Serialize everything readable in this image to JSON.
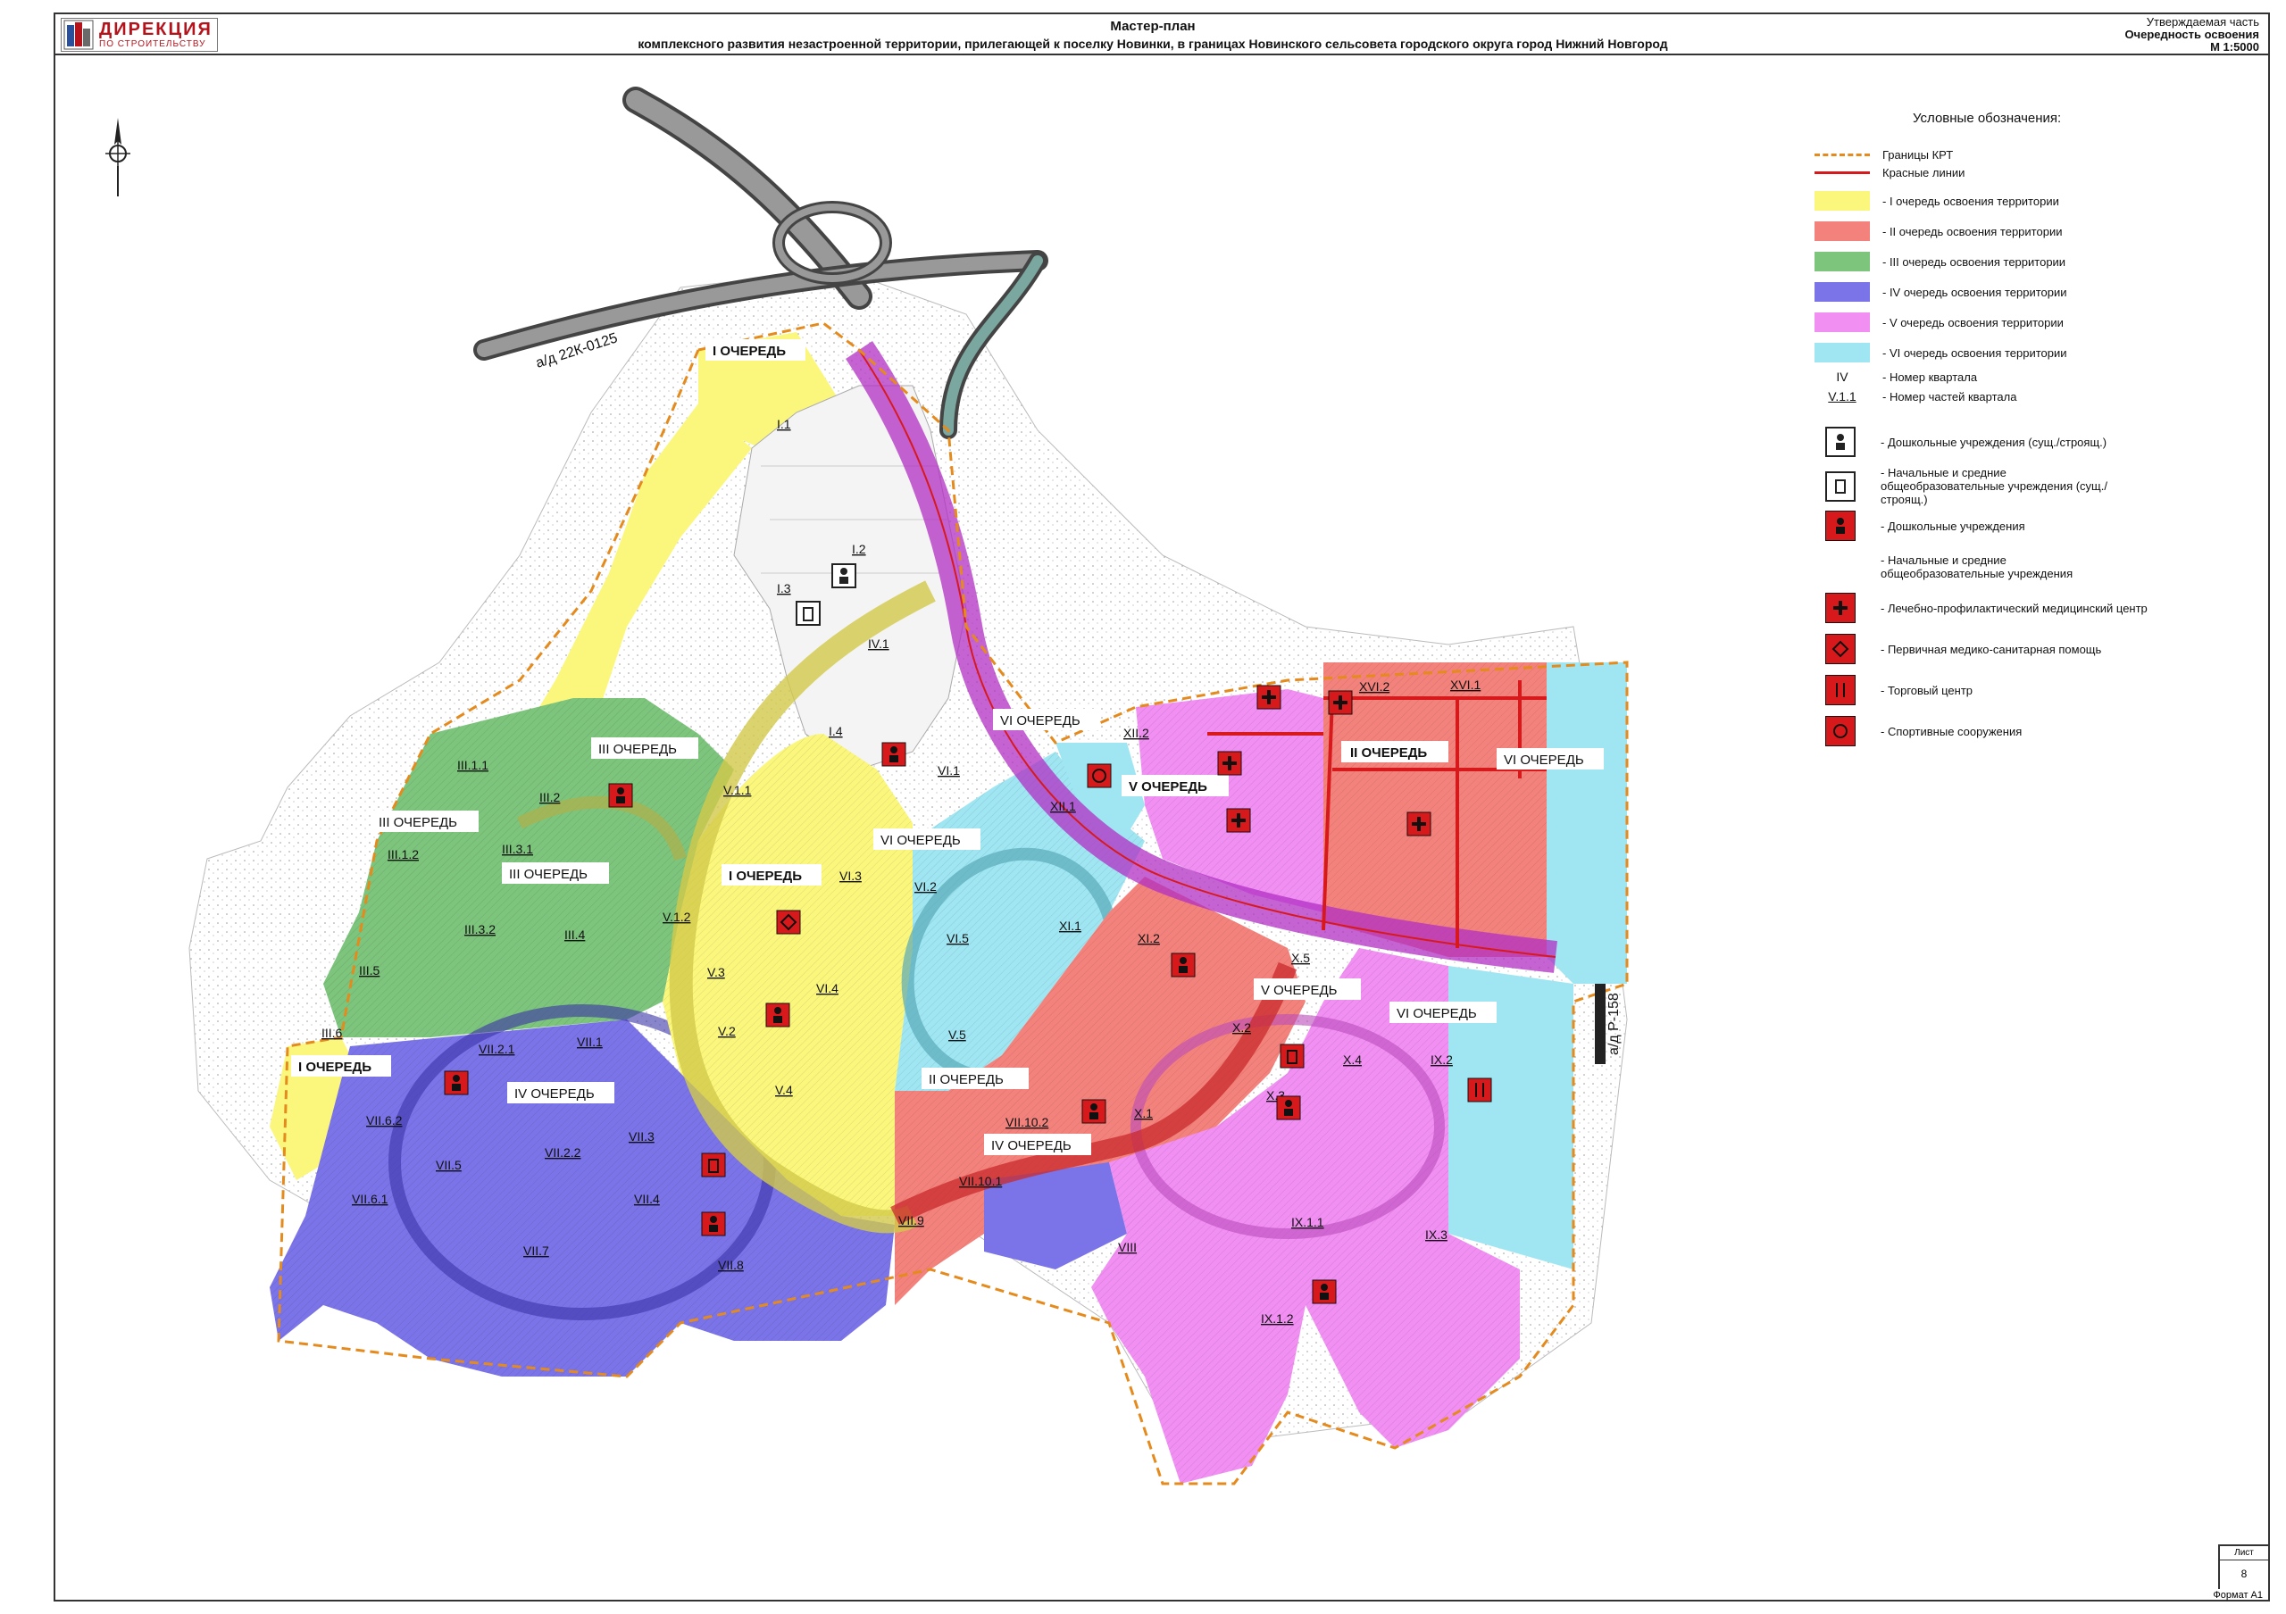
{
  "title_block": {
    "logo": {
      "line1": "ДИРЕКЦИЯ",
      "line2": "ПО СТРОИТЕЛЬСТВУ"
    },
    "title": "Мастер-план",
    "subtitle": "комплексного развития незастроенной территории, прилегающей к поселку Новинки, в границах Новинского сельсовета городского округа город Нижний Новгород",
    "right_top": "Утверждаемая часть",
    "right_mid": "Очередность освоения",
    "right_scale": "М 1:5000"
  },
  "legend": {
    "heading": "Условные обозначения:",
    "lines": [
      {
        "label": "Границы КРТ",
        "color": "#e58a1c",
        "style": "dashed"
      },
      {
        "label": "Красные линии",
        "color": "#d7191c",
        "style": "solid"
      }
    ],
    "phases": [
      {
        "label": "- I очередь освоения территории",
        "color": "#fbf77d"
      },
      {
        "label": "- II очередь освоения территории",
        "color": "#f4827c"
      },
      {
        "label": "- III очередь освоения территории",
        "color": "#7dc47c"
      },
      {
        "label": "- IV очередь освоения территории",
        "color": "#7b74e8"
      },
      {
        "label": "- V очередь освоения территории",
        "color": "#f18ff3"
      },
      {
        "label": "- VI очередь освоения территории",
        "color": "#9fe6f2"
      }
    ],
    "codes": [
      {
        "code": "IV",
        "label": "- Номер квартала"
      },
      {
        "code": "V.1.1",
        "label": "- Номер частей квартала"
      }
    ],
    "icons": [
      {
        "icon": "kindergarten-icon",
        "variant": "outline",
        "label": "- Дошкольные учреждения (сущ./строящ.)"
      },
      {
        "icon": "school-icon",
        "variant": "outline",
        "label": "- Начальные и средние общеобразовательные учреждения (сущ./строящ.)"
      },
      {
        "icon": "kindergarten-icon",
        "variant": "red",
        "label": "- Дошкольные учреждения"
      },
      {
        "icon": "school-icon",
        "variant": "none",
        "label": "- Начальные и средние общеобразовательные учреждения"
      },
      {
        "icon": "medical-cross-icon",
        "variant": "red",
        "label": "- Лечебно-профилактический медицинский центр"
      },
      {
        "icon": "primary-care-icon",
        "variant": "red",
        "label": "- Первичная медико-санитарная помощь"
      },
      {
        "icon": "shopping-icon",
        "variant": "red",
        "label": "- Торговый центр"
      },
      {
        "icon": "sports-icon",
        "variant": "red",
        "label": "- Спортивные сооружения"
      }
    ]
  },
  "map": {
    "roads": [
      {
        "label": "а/д 22К-0125"
      },
      {
        "label": "а/д Р-158"
      }
    ],
    "phase_labels": [
      {
        "text": "I ОЧЕРЕДЬ",
        "bold": true
      },
      {
        "text": "I ОЧЕРЕДЬ",
        "bold": true
      },
      {
        "text": "I ОЧЕРЕДЬ",
        "bold": true
      },
      {
        "text": "II ОЧЕРЕДЬ",
        "bold": true
      },
      {
        "text": "II ОЧЕРЕДЬ",
        "bold": false
      },
      {
        "text": "III ОЧЕРЕДЬ",
        "bold": false
      },
      {
        "text": "III ОЧЕРЕДЬ",
        "bold": false
      },
      {
        "text": "III ОЧЕРЕДЬ",
        "bold": false
      },
      {
        "text": "IV ОЧЕРЕДЬ",
        "bold": false
      },
      {
        "text": "IV ОЧЕРЕДЬ",
        "bold": false
      },
      {
        "text": "V ОЧЕРЕДЬ",
        "bold": true
      },
      {
        "text": "V ОЧЕРЕДЬ",
        "bold": false
      },
      {
        "text": "VI ОЧЕРЕДЬ",
        "bold": false
      },
      {
        "text": "VI ОЧЕРЕДЬ",
        "bold": false
      },
      {
        "text": "VI ОЧЕРЕДЬ",
        "bold": false
      },
      {
        "text": "VI ОЧЕРЕДЬ",
        "bold": false
      }
    ],
    "block_codes": [
      "I.1",
      "I.2",
      "I.3",
      "IV.1",
      "I.4",
      "III.1.1",
      "III.1.2",
      "III.2",
      "III.3.1",
      "III.3.2",
      "III.4",
      "III.5",
      "III.6",
      "V.1.1",
      "V.1.2",
      "V.3",
      "V.2",
      "V.4",
      "V.5",
      "VI.1",
      "VI.3",
      "VI.2",
      "VI.5",
      "VI.4",
      "VII.1",
      "VII.2.1",
      "VII.2.2",
      "VII.3",
      "VII.4",
      "VII.5",
      "VII.6.1",
      "VII.6.2",
      "VII.7",
      "VII.8",
      "VII.9",
      "VII.10.1",
      "VII.10.2",
      "XI.1",
      "XI.2",
      "XII.1",
      "XII.2",
      "X.1",
      "X.2",
      "X.3",
      "X.4",
      "X.5",
      "IX.1.1",
      "IX.1.2",
      "IX.2",
      "IX.3",
      "VIII",
      "XVI.1",
      "XVI.2"
    ]
  },
  "stamp": {
    "label": "Лист",
    "number": "8",
    "format": "Формат А1"
  }
}
